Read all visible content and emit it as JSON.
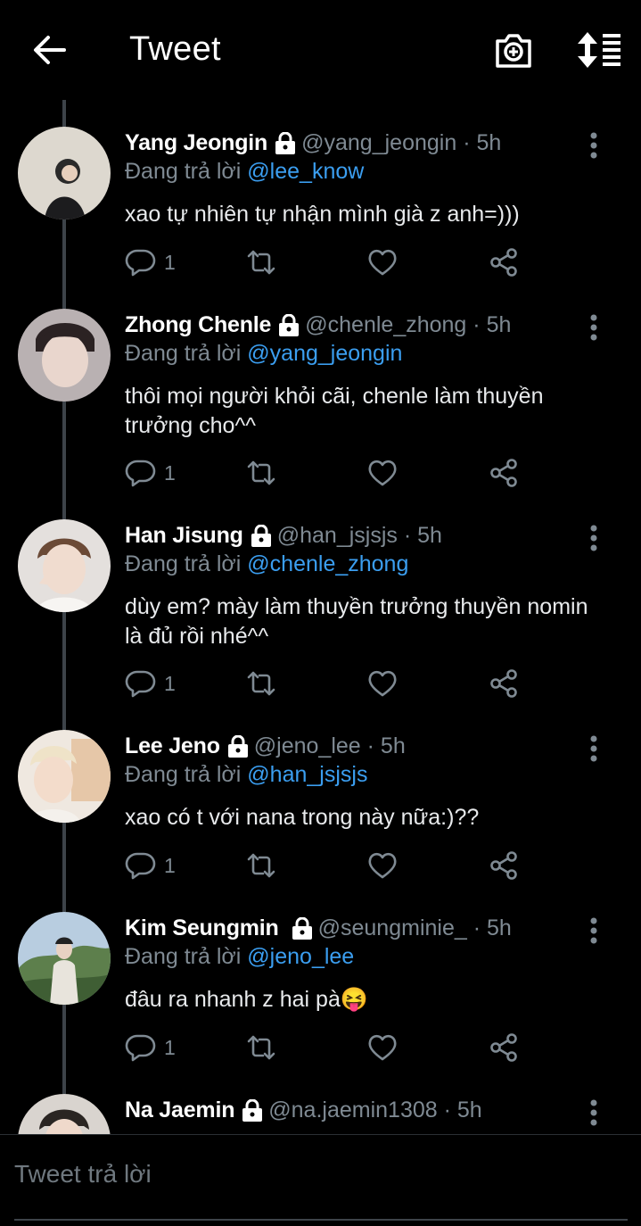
{
  "header": {
    "title": "Tweet"
  },
  "tweets": [
    {
      "name": "Yang Jeongin",
      "handle": "@yang_jeongin",
      "time": "· 5h",
      "reply_prefix": "Đang trả lời",
      "reply_to": "@lee_know",
      "text": "xao tự nhiên tự nhận mình già z anh=)))",
      "reply_count": "1"
    },
    {
      "name": "Zhong Chenle",
      "handle": "@chenle_zhong",
      "time": "· 5h",
      "reply_prefix": "Đang trả lời",
      "reply_to": "@yang_jeongin",
      "text": "thôi mọi người khỏi cãi, chenle làm thuyền trưởng cho^^",
      "reply_count": "1"
    },
    {
      "name": "Han Jisung",
      "handle": "@han_jsjsjs",
      "time": "· 5h",
      "reply_prefix": "Đang trả lời",
      "reply_to": "@chenle_zhong",
      "text": "dùy em? mày làm thuyền trưởng thuyền nomin là đủ rồi nhé^^",
      "reply_count": "1"
    },
    {
      "name": "Lee Jeno",
      "handle": "@jeno_lee",
      "time": "· 5h",
      "reply_prefix": "Đang trả lời",
      "reply_to": "@han_jsjsjs",
      "text": "xao có t với nana trong này nữa:)??",
      "reply_count": "1"
    },
    {
      "name": "Kim Seungmin",
      "handle": "@seungminie_",
      "time": "· 5h",
      "reply_prefix": "Đang trả lời",
      "reply_to": "@jeno_lee",
      "text": "đâu ra nhanh z hai pà😝",
      "reply_count": "1"
    },
    {
      "name": "Na Jaemin",
      "handle": "@na.jaemin1308",
      "time": "· 5h"
    }
  ],
  "compose": {
    "placeholder": "Tweet trả lời"
  },
  "colors": {
    "background": "#000000",
    "muted": "#7f8a93",
    "accent": "#3b9ef0",
    "thread_line": "#3d4349"
  },
  "icons": [
    "back-arrow-icon",
    "camera-plus-icon",
    "sort-icon",
    "lock-icon",
    "more-vertical-icon",
    "reply-icon",
    "retweet-icon",
    "like-icon",
    "share-icon"
  ]
}
